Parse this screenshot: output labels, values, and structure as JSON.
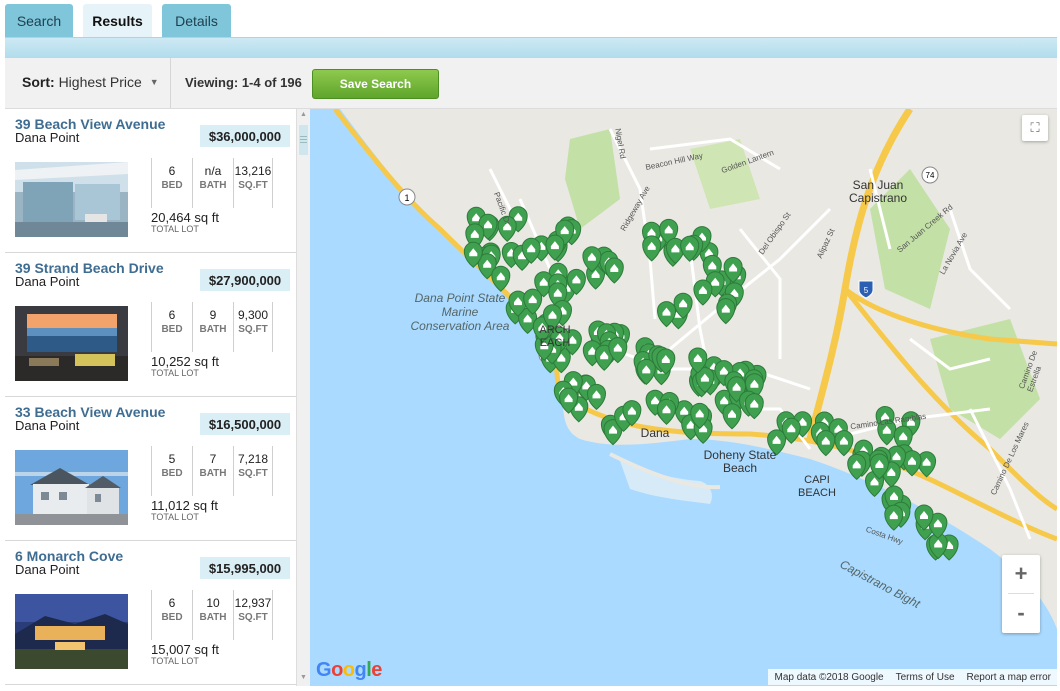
{
  "tabs": [
    {
      "label": "Search"
    },
    {
      "label": "Results"
    },
    {
      "label": "Details"
    }
  ],
  "toolbar": {
    "sort_label": "Sort:",
    "sort_value": "Highest Price",
    "viewing": "Viewing: 1-4 of 196",
    "save_label": "Save Search"
  },
  "listings": [
    {
      "title": "39 Beach View Avenue",
      "city": "Dana Point",
      "price": "$36,000,000",
      "bed": "6",
      "bath": "n/a",
      "sqft": "13,216",
      "lot": "20,464 sq ft"
    },
    {
      "title": "39 Strand Beach Drive",
      "city": "Dana Point",
      "price": "$27,900,000",
      "bed": "6",
      "bath": "9",
      "sqft": "9,300",
      "lot": "10,252 sq ft"
    },
    {
      "title": "33 Beach View Avenue",
      "city": "Dana Point",
      "price": "$16,500,000",
      "bed": "5",
      "bath": "7",
      "sqft": "7,218",
      "lot": "11,012 sq ft"
    },
    {
      "title": "6 Monarch Cove",
      "city": "Dana Point",
      "price": "$15,995,000",
      "bed": "6",
      "bath": "10",
      "sqft": "12,937",
      "lot": "15,007 sq ft"
    }
  ],
  "stat_keys": {
    "bed": "BED",
    "bath": "BATH",
    "sqft": "SQ.FT",
    "lot": "TOTAL LOT"
  },
  "map": {
    "labels": {
      "san_juan": "San Juan Capistrano",
      "marine": "Dana Point State Marine Conservation Area",
      "doheny": "Doheny State Beach",
      "dana": "Dana",
      "harbor": "ARCH EACH",
      "capo": "CAPI BEACH",
      "bight": "Capistrano Bight"
    },
    "streets": [
      "Nigel Rd",
      "Beacon Hill Way",
      "Golden Lantern",
      "Ridgeway Ave",
      "Pacific Dr",
      "Del Obispo St",
      "Alipaz St",
      "San Juan Creek Rd",
      "La Novia Ave",
      "Camino Las Ramblas",
      "Camino De Los Mares",
      "Camino De Estrella",
      "Costa Hwy"
    ],
    "shields": [
      "1",
      "1",
      "74",
      "5"
    ],
    "google": "Google",
    "attribution": [
      "Map data ©2018 Google",
      "Terms of Use",
      "Report a map error"
    ],
    "zoom_in": "+",
    "zoom_out": "-",
    "colors": {
      "water": "#aadaff",
      "land": "#e9e8e3",
      "park": "#c3e0a6",
      "freeway": "#f6c94b",
      "marker": "#3fa14f"
    }
  }
}
